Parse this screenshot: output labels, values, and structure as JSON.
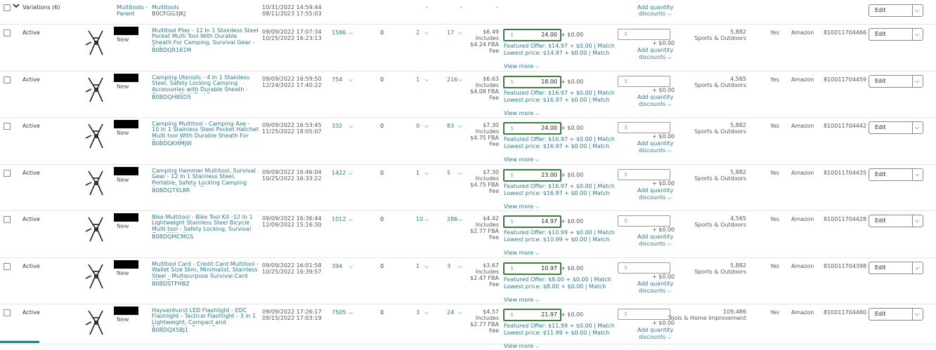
{
  "header": {
    "label": "Variations (6)",
    "toggle_icon": "chevron-down-icon",
    "parent_line1": "Multitools -",
    "parent_line2": "Parent",
    "brand": "Multitools",
    "asin": "B0CFGG3JKJ",
    "date1": "10/31/2022 14:59:44",
    "date2": "08/11/2023 17:55:03",
    "dash1": "-",
    "dash2": "-",
    "dash3": "-",
    "add_qty": "Add quantity",
    "discounts": "discounts ⌵",
    "edit": "Edit",
    "edit_dropdown": "⌵"
  },
  "common": {
    "status": "Active",
    "condition": "New",
    "includes": "Includes",
    "fee": "Fee",
    "currency": "$",
    "plus_zero": "+ $0.00",
    "view_more": "View more ⌵",
    "add_qty": "Add quantity",
    "discounts": "discounts ⌵",
    "yes": "Yes",
    "channel": "Amazon",
    "edit": "Edit",
    "edit_dropdown": "⌵",
    "chev": "⌵"
  },
  "rows": [
    {
      "title": "Multitool Plier - 12 In 1 Stainless Steel Pocket Multi Tool With Durable Sheath For Camping, Survival Gear - Safety Locking...",
      "asin": "B0BDQR161M",
      "created": "09/09/2022 17:07:34",
      "updated": "10/25/2022 16:23:13",
      "available": "1586",
      "inbound": "0",
      "reserved": "2",
      "unfulfillable": "17",
      "fee_price": "$6.49",
      "fba_fee": "$4.24 FBA",
      "price": "24.00",
      "featured": "Featured Offer: $14.97 + $0.00 | Match",
      "lowest": "Lowest price: $14.97 + $0.00 | Match",
      "rank": "5,882",
      "category": "Sports & Outdoors",
      "sku": "810011704466"
    },
    {
      "title": "Camping Utensils - 4 In 1 Stainless Steel, Safety Locking Camping Accessories with Durable Sheath - Compact Multi Tool For...",
      "asin": "B0BDQH8SD5",
      "created": "09/09/2022 16:59:50",
      "updated": "12/24/2022 17:40:22",
      "available": "754",
      "inbound": "0",
      "reserved": "1",
      "unfulfillable": "216",
      "fee_price": "$6.63",
      "fba_fee": "$4.08 FBA",
      "price": "18.00",
      "featured": "Featured Offer: $16.97 + $0.00 | Match",
      "lowest": "Lowest price: $16.97 + $0.00 | Match",
      "rank": "4,565",
      "category": "Sports & Outdoors",
      "sku": "810011704459"
    },
    {
      "title": "Camping Multitool - Camping Axe - 10 In 1 Stainless Steel Pocket Hatchet Multi tool With Durable Sheath For Outdoor, Sur...",
      "asin": "B0BDQKHMJW",
      "created": "09/09/2022 16:53:45",
      "updated": "11/25/2022 18:05:07",
      "available": "332",
      "inbound": "0",
      "reserved": "0",
      "unfulfillable": "83",
      "fee_price": "$7.30",
      "fba_fee": "$4.75 FBA",
      "price": "24.00",
      "featured": "Featured Offer: $16.97 + $0.00 | Match",
      "lowest": "Lowest price: $16.97 + $0.00 | Match",
      "rank": "5,882",
      "category": "Sports & Outdoors",
      "sku": "810011704442"
    },
    {
      "title": "Camping Hammer Multitool, Survival Gear - 12 In 1 Stainless Steel, Portable, Safety Locking Camping Accessories with Dur...",
      "asin": "B0BDQ7XL8R",
      "created": "09/09/2022 16:46:04",
      "updated": "10/25/2022 16:33:22",
      "available": "1422",
      "inbound": "0",
      "reserved": "1",
      "unfulfillable": "5",
      "fee_price": "$7.30",
      "fba_fee": "$4.75 FBA",
      "price": "23.00",
      "featured": "Featured Offer: $16.97 + $0.00 | Match",
      "lowest": "Lowest price: $16.97 + $0.00 | Match",
      "rank": "5,882",
      "category": "Sports & Outdoors",
      "sku": "810011704435"
    },
    {
      "title": "Bike Multitool - Bike Tool Kit -12 In 1 Lightweight Stainless Steel Bicycle Multi tool - Safety Locking, Survival Gear With He...",
      "asin": "B0BDQMCMGS",
      "created": "09/09/2022 16:36:44",
      "updated": "12/09/2022 15:16:30",
      "available": "1012",
      "inbound": "0",
      "reserved": "10",
      "unfulfillable": "286",
      "fee_price": "$4.42",
      "fba_fee": "$2.77 FBA",
      "price": "14.97",
      "featured": "Featured Offer: $10.99 + $0.00 | Match",
      "lowest": "Lowest price: $10.99 + $0.00 | Match",
      "rank": "4,565",
      "category": "Sports & Outdoors",
      "sku": "810011704428"
    },
    {
      "title": "Multitool Card - Credit Card Multitool - Wallet Size Slim, Minimalist, Stainless Steel - Multipurpose Survival Card With Can O...",
      "asin": "B0BDSTFHBZ",
      "created": "09/09/2022 16:01:58",
      "updated": "10/25/2022 16:39:57",
      "available": "394",
      "inbound": "0",
      "reserved": "1",
      "unfulfillable": "3",
      "fee_price": "$3.67",
      "fba_fee": "$2.47 FBA",
      "price": "10.97",
      "featured": "Featured Offer: $8.00 + $0.00 | Match",
      "lowest": "Lowest price: $8.00 + $0.00 | Match",
      "rank": "5,882",
      "category": "Sports & Outdoors",
      "sku": "810011704398"
    },
    {
      "title": "Hayvenhurst LED Flashlight - EDC Flashlight - Tactical Flashlight - 3 in 1 Lightweight, Compact and Rechargeable Pocket F...",
      "asin": "B0BDQX5BJ1",
      "created": "09/09/2022 17:26:17",
      "updated": "09/15/2022 17:03:19",
      "available": "7505",
      "inbound": "0",
      "reserved": "3",
      "unfulfillable": "24",
      "fee_price": "$4.57",
      "fba_fee": "$2.77 FBA",
      "price": "21.97",
      "featured": "Featured Offer: $11.99 + $0.00 | Match",
      "lowest": "Lowest price: $11.99 + $0.00 | Match",
      "rank": "109,486",
      "category": "Tools & Home Improvement",
      "sku": "810011704480"
    }
  ]
}
